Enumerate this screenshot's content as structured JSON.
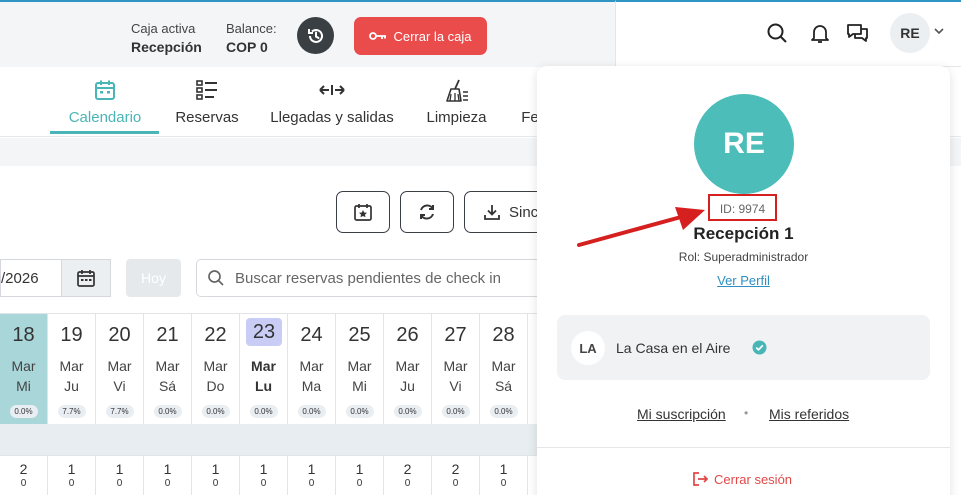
{
  "header": {
    "cash_label": "Caja activa",
    "cash_value": "Recepción",
    "balance_label": "Balance:",
    "balance_value": "COP 0",
    "close_cash_label": "Cerrar la caja",
    "user_initials": "RE"
  },
  "nav": {
    "items": [
      {
        "label": "Calendario"
      },
      {
        "label": "Reservas"
      },
      {
        "label": "Llegadas y salidas"
      },
      {
        "label": "Limpieza"
      },
      {
        "label": "Fe"
      }
    ]
  },
  "toolbar": {
    "sync_label": "Sinc"
  },
  "filters": {
    "date_value": "/2026",
    "today_label": "Hoy",
    "search_placeholder": "Buscar reservas pendientes de check in"
  },
  "days": [
    {
      "num": "18",
      "month": "Mar",
      "weekday": "Mi",
      "pct": "0.0%",
      "a": "2",
      "b": "0"
    },
    {
      "num": "19",
      "month": "Mar",
      "weekday": "Ju",
      "pct": "7.7%",
      "a": "1",
      "b": "0"
    },
    {
      "num": "20",
      "month": "Mar",
      "weekday": "Vi",
      "pct": "7.7%",
      "a": "1",
      "b": "0"
    },
    {
      "num": "21",
      "month": "Mar",
      "weekday": "Sá",
      "pct": "0.0%",
      "a": "1",
      "b": "0"
    },
    {
      "num": "22",
      "month": "Mar",
      "weekday": "Do",
      "pct": "0.0%",
      "a": "1",
      "b": "0"
    },
    {
      "num": "23",
      "month": "Mar",
      "weekday": "Lu",
      "pct": "0.0%",
      "a": "1",
      "b": "0"
    },
    {
      "num": "24",
      "month": "Mar",
      "weekday": "Ma",
      "pct": "0.0%",
      "a": "1",
      "b": "0"
    },
    {
      "num": "25",
      "month": "Mar",
      "weekday": "Mi",
      "pct": "0.0%",
      "a": "1",
      "b": "0"
    },
    {
      "num": "26",
      "month": "Mar",
      "weekday": "Ju",
      "pct": "0.0%",
      "a": "2",
      "b": "0"
    },
    {
      "num": "27",
      "month": "Mar",
      "weekday": "Vi",
      "pct": "0.0%",
      "a": "2",
      "b": "0"
    },
    {
      "num": "28",
      "month": "Mar",
      "weekday": "Sá",
      "pct": "0.0%",
      "a": "1",
      "b": "0"
    }
  ],
  "profile": {
    "initials": "RE",
    "id_text": "ID: 9974",
    "name": "Recepción 1",
    "role": "Rol: Superadministrador",
    "view_profile": "Ver Perfil",
    "property_initials": "LA",
    "property_name": "La Casa en el Aire",
    "subscription_link": "Mi suscripción",
    "separator": "•",
    "referrals_link": "Mis referidos",
    "logout_label": "Cerrar sesión"
  },
  "colors": {
    "accent": "#4ab5b6",
    "danger": "#ea4b4b",
    "link": "#2f8fc2",
    "annotation": "#d62020"
  }
}
